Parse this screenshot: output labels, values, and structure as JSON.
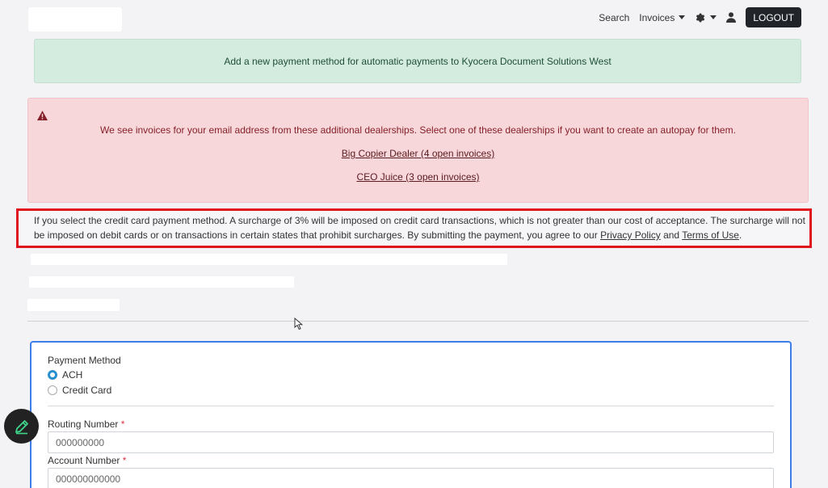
{
  "header": {
    "nav": {
      "search_label": "Search",
      "invoices_label": "Invoices",
      "logout_label": "LOGOUT"
    }
  },
  "success_alert": {
    "message": "Add a new payment method for automatic payments to Kyocera Document Solutions West"
  },
  "danger_alert": {
    "icon": "warning-triangle-icon",
    "message": "We see invoices for your email address from these additional dealerships. Select one of these dealerships if you want to create an autopay for them.",
    "dealers": [
      {
        "label": "Big Copier Dealer (4 open invoices)"
      },
      {
        "label": "CEO Juice (3 open invoices)"
      }
    ]
  },
  "surcharge_notice": {
    "text_before": "If you select the credit card payment method. A surcharge of 3% will be imposed on credit card transactions, which is not greater than our cost of acceptance. The surcharge will not be imposed on debit cards or on transactions in certain states that prohibit surcharges. By submitting the payment, you agree to our ",
    "privacy_link": "Privacy Policy",
    "and_text": " and ",
    "terms_link": "Terms of Use",
    "period": "."
  },
  "form": {
    "payment_method_label": "Payment Method",
    "methods": [
      {
        "label": "ACH",
        "selected": true
      },
      {
        "label": "Credit Card",
        "selected": false
      }
    ],
    "routing": {
      "label": "Routing Number",
      "required_mark": "*",
      "placeholder": "000000000"
    },
    "account": {
      "label": "Account Number",
      "required_mark": "*",
      "placeholder": "000000000000"
    }
  },
  "colors": {
    "success_bg": "#d4ebe0",
    "danger_bg": "#f8d7da",
    "highlight_border": "#e0141e",
    "form_border": "#3d7fe6",
    "radio_selected": "#2a8fcf"
  }
}
